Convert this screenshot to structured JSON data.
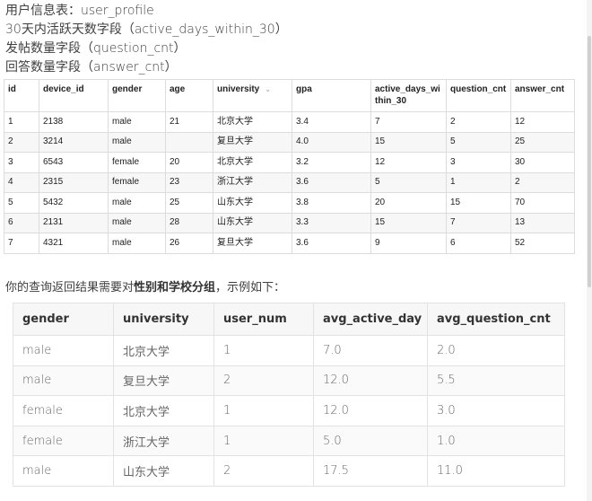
{
  "intro": {
    "lines": [
      "用户信息表：user_profile",
      "30天内活跃天数字段（active_days_within_30）",
      "发帖数量字段（question_cnt）",
      "回答数量字段（answer_cnt）"
    ]
  },
  "user_profile": {
    "headers": [
      "id",
      "device_id",
      "gender",
      "age",
      "university",
      "gpa",
      "active_days_within_30",
      "question_cnt",
      "answer_cnt"
    ],
    "rows": [
      [
        "1",
        "2138",
        "male",
        "21",
        "北京大学",
        "3.4",
        "7",
        "2",
        "12"
      ],
      [
        "2",
        "3214",
        "male",
        "",
        "复旦大学",
        "4.0",
        "15",
        "5",
        "25"
      ],
      [
        "3",
        "6543",
        "female",
        "20",
        "北京大学",
        "3.2",
        "12",
        "3",
        "30"
      ],
      [
        "4",
        "2315",
        "female",
        "23",
        "浙江大学",
        "3.6",
        "5",
        "1",
        "2"
      ],
      [
        "5",
        "5432",
        "male",
        "25",
        "山东大学",
        "3.8",
        "20",
        "15",
        "70"
      ],
      [
        "6",
        "2131",
        "male",
        "28",
        "山东大学",
        "3.3",
        "15",
        "7",
        "13"
      ],
      [
        "7",
        "4321",
        "male",
        "26",
        "复旦大学",
        "3.6",
        "9",
        "6",
        "52"
      ]
    ]
  },
  "query": {
    "prefix": "你的查询返回结果需要对",
    "bold": "性别和学校分组",
    "suffix": "，示例如下："
  },
  "result": {
    "headers": [
      "gender",
      "university",
      "user_num",
      "avg_active_day",
      "avg_question_cnt"
    ],
    "rows": [
      [
        "male",
        "北京大学",
        "1",
        "7.0",
        "2.0"
      ],
      [
        "male",
        "复旦大学",
        "2",
        "12.0",
        "5.5"
      ],
      [
        "female",
        "北京大学",
        "1",
        "12.0",
        "3.0"
      ],
      [
        "female",
        "浙江大学",
        "1",
        "5.0",
        "1.0"
      ],
      [
        "male",
        "山东大学",
        "2",
        "17.5",
        "11.0"
      ]
    ]
  }
}
